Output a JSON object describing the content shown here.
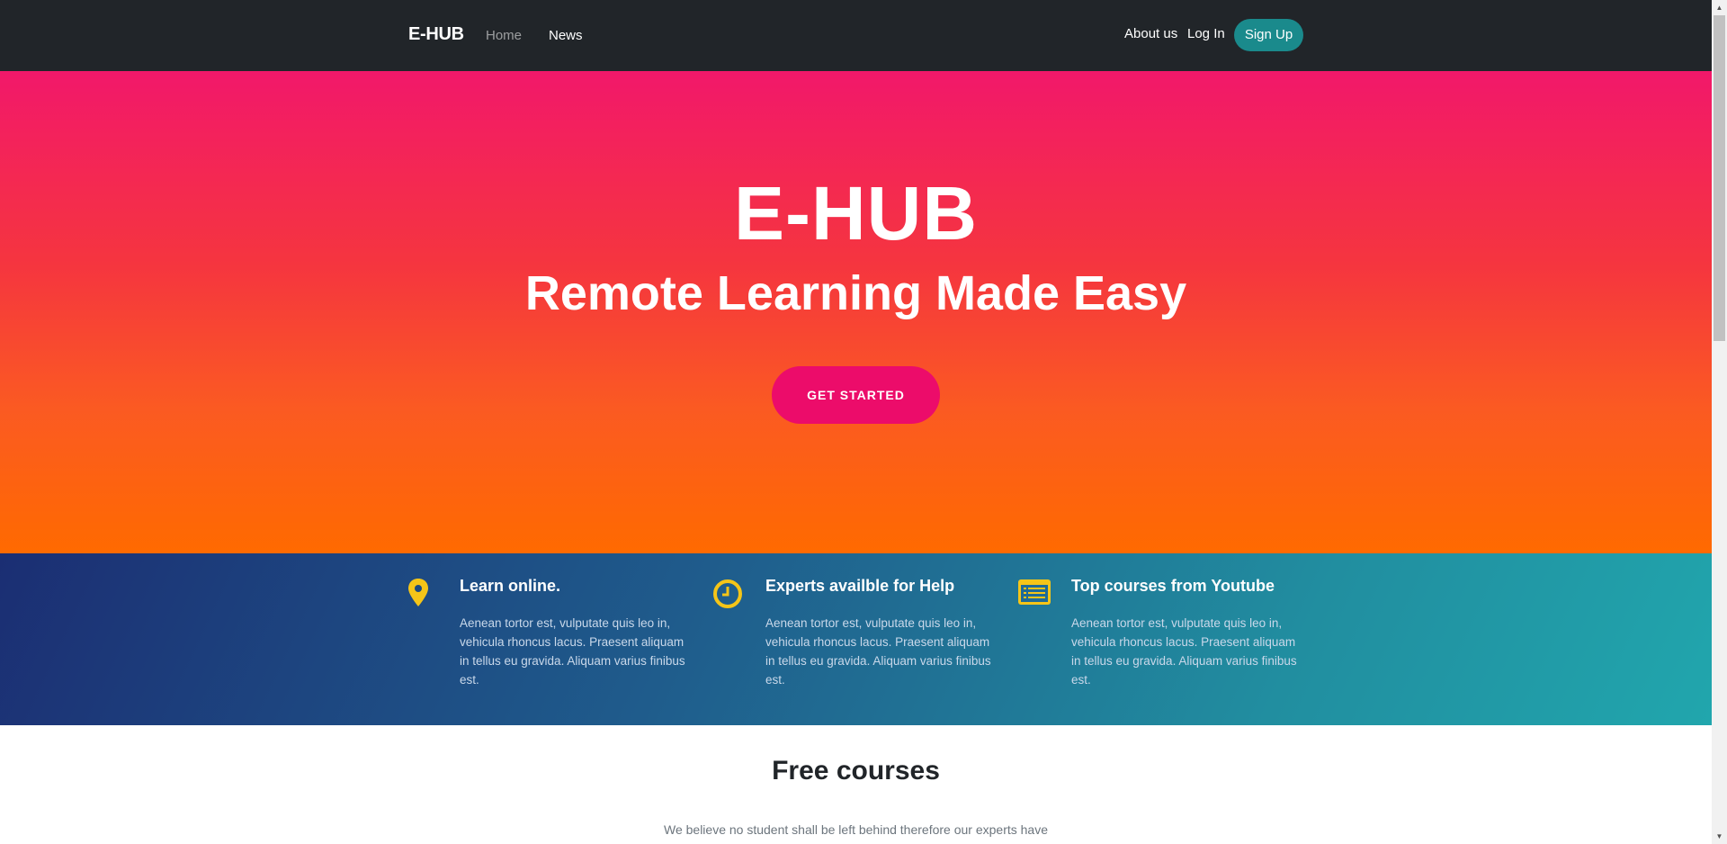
{
  "navbar": {
    "brand": "E-HUB",
    "links": [
      "Home",
      "News"
    ],
    "about": "About us",
    "login": "Log In",
    "signup": "Sign Up"
  },
  "hero": {
    "title": "E-HUB",
    "subtitle": "Remote Learning Made Easy",
    "cta": "GET STARTED"
  },
  "features": [
    {
      "icon": "map-pin-icon",
      "title": "Learn online.",
      "text": "Aenean tortor est, vulputate quis leo in, vehicula rhoncus lacus. Praesent aliquam in tellus eu gravida. Aliquam varius finibus est."
    },
    {
      "icon": "clock-icon",
      "title": "Experts availble for Help",
      "text": "Aenean tortor est, vulputate quis leo in, vehicula rhoncus lacus. Praesent aliquam in tellus eu gravida. Aliquam varius finibus est."
    },
    {
      "icon": "list-card-icon",
      "title": "Top courses from Youtube",
      "text": "Aenean tortor est, vulputate quis leo in, vehicula rhoncus lacus. Praesent aliquam in tellus eu gravida. Aliquam varius finibus est."
    }
  ],
  "courses": {
    "title": "Free courses",
    "intro": "We believe no student shall be left behind therefore our experts have"
  },
  "colors": {
    "navbar_bg": "#212529",
    "accent_teal": "#1a8a8c",
    "cta_pink": "#ec0c6a",
    "icon_yellow": "#f5c518"
  }
}
